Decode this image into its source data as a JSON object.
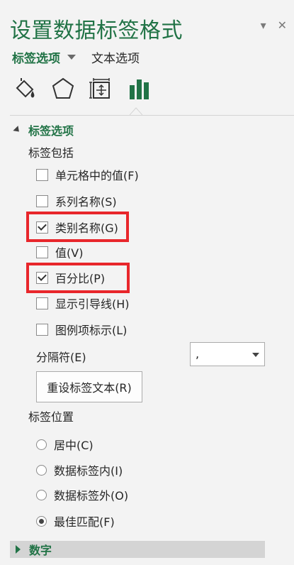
{
  "pane": {
    "title": "设置数据标签格式"
  },
  "tabs": {
    "label_options": "标签选项",
    "text_options": "文本选项"
  },
  "icons": [
    "fill-line-icon",
    "effects-pentagon-icon",
    "size-properties-icon",
    "bar-chart-options-icon"
  ],
  "section": {
    "title": "标签选项",
    "include_label": "标签包括",
    "checkboxes": [
      {
        "label": "单元格中的值(F)",
        "checked": false
      },
      {
        "label": "系列名称(S)",
        "checked": false
      },
      {
        "label": "类别名称(G)",
        "checked": true,
        "highlighted": true
      },
      {
        "label": "值(V)",
        "checked": false
      },
      {
        "label": "百分比(P)",
        "checked": true,
        "highlighted": true
      },
      {
        "label": "显示引导线(H)",
        "checked": false
      },
      {
        "label": "图例项标示(L)",
        "checked": false
      }
    ],
    "separator_label": "分隔符(E)",
    "separator_value": ",",
    "reset_button": "重设标签文本(R)",
    "position_label": "标签位置",
    "positions": [
      {
        "label": "居中(C)",
        "selected": false
      },
      {
        "label": "数据标签内(I)",
        "selected": false
      },
      {
        "label": "数据标签外(O)",
        "selected": false
      },
      {
        "label": "最佳匹配(F)",
        "selected": true
      }
    ]
  },
  "number_section": {
    "title": "数字"
  },
  "colors": {
    "accent": "#217346",
    "highlight": "#e8262b"
  }
}
